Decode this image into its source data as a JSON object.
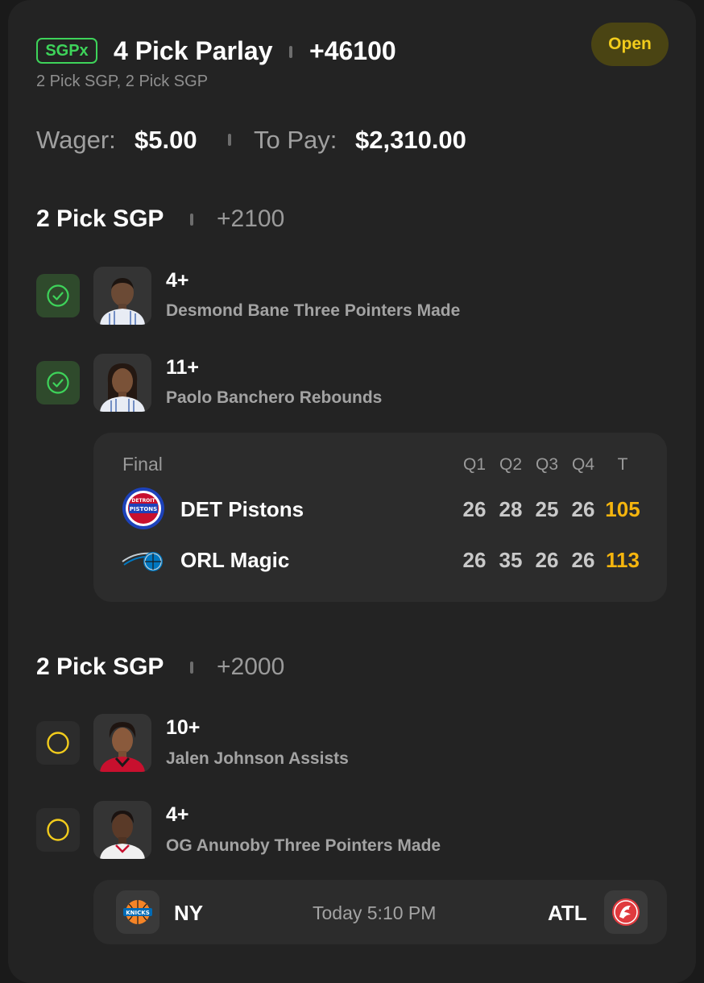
{
  "header": {
    "badge": "SGPx",
    "title": "4 Pick Parlay",
    "odds": "+46100",
    "subtitle": "2 Pick SGP, 2 Pick SGP",
    "status": "Open"
  },
  "wager": {
    "wager_label": "Wager:",
    "wager_value": "$5.00",
    "topay_label": "To Pay:",
    "topay_value": "$2,310.00"
  },
  "sgp1": {
    "title": "2 Pick SGP",
    "odds": "+2100",
    "legs": [
      {
        "line": "4+",
        "desc": "Desmond Bane Three Pointers Made",
        "status": "won",
        "headshot": "player-headshot"
      },
      {
        "line": "11+",
        "desc": "Paolo Banchero Rebounds",
        "status": "won",
        "headshot": "player-headshot"
      }
    ],
    "scoreboard": {
      "status": "Final",
      "headers": [
        "Q1",
        "Q2",
        "Q3",
        "Q4",
        "T"
      ],
      "teams": [
        {
          "name": "DET Pistons",
          "logo": "pistons-logo",
          "quarters": [
            "26",
            "28",
            "25",
            "26"
          ],
          "total": "105"
        },
        {
          "name": "ORL Magic",
          "logo": "magic-logo",
          "quarters": [
            "26",
            "35",
            "26",
            "26"
          ],
          "total": "113"
        }
      ]
    }
  },
  "sgp2": {
    "title": "2 Pick SGP",
    "odds": "+2000",
    "legs": [
      {
        "line": "10+",
        "desc": "Jalen Johnson Assists",
        "status": "open",
        "headshot": "player-headshot"
      },
      {
        "line": "4+",
        "desc": "OG Anunoby Three Pointers Made",
        "status": "open",
        "headshot": "player-headshot"
      }
    ],
    "game": {
      "away": "NY",
      "away_logo": "knicks-logo",
      "time": "Today 5:10 PM",
      "home": "ATL",
      "home_logo": "hawks-logo"
    }
  },
  "colors": {
    "win_green": "#3ed35a",
    "open_yellow": "#f2cc1c",
    "total_gold": "#f5b50e",
    "card_bg": "#232323"
  }
}
